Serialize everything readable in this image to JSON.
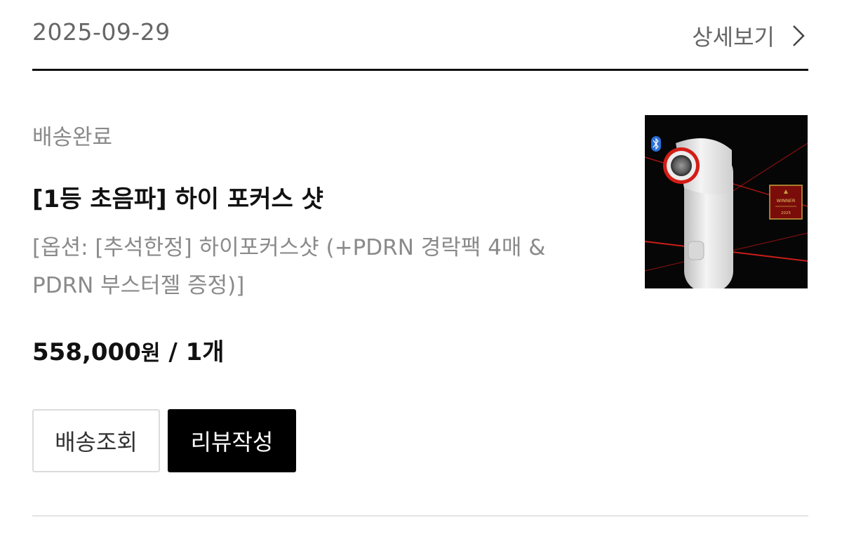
{
  "order": {
    "date": "2025-09-29",
    "detail_label": "상세보기"
  },
  "item": {
    "status": "배송완료",
    "title": "[1등 초음파] 하이 포커스 샷",
    "options_line1": "[옵션: [추석한정] 하이포커스샷 (+PDRN 경락팩 4매 &",
    "options_line2": "PDRN 부스터젤 증정)]",
    "price": "558,000",
    "currency": "원",
    "quantity": "/ 1개",
    "image_badge": "WINNER",
    "image_badge_year": "2025"
  },
  "buttons": {
    "track_label": "배송조회",
    "review_label": "리뷰작성"
  },
  "colors": {
    "primary_button": "#000000",
    "muted_text": "#8a8a8a",
    "accent_red": "#e0201a"
  },
  "icons": {
    "detail": "chevron-right-icon",
    "bluetooth": "bluetooth-icon"
  }
}
